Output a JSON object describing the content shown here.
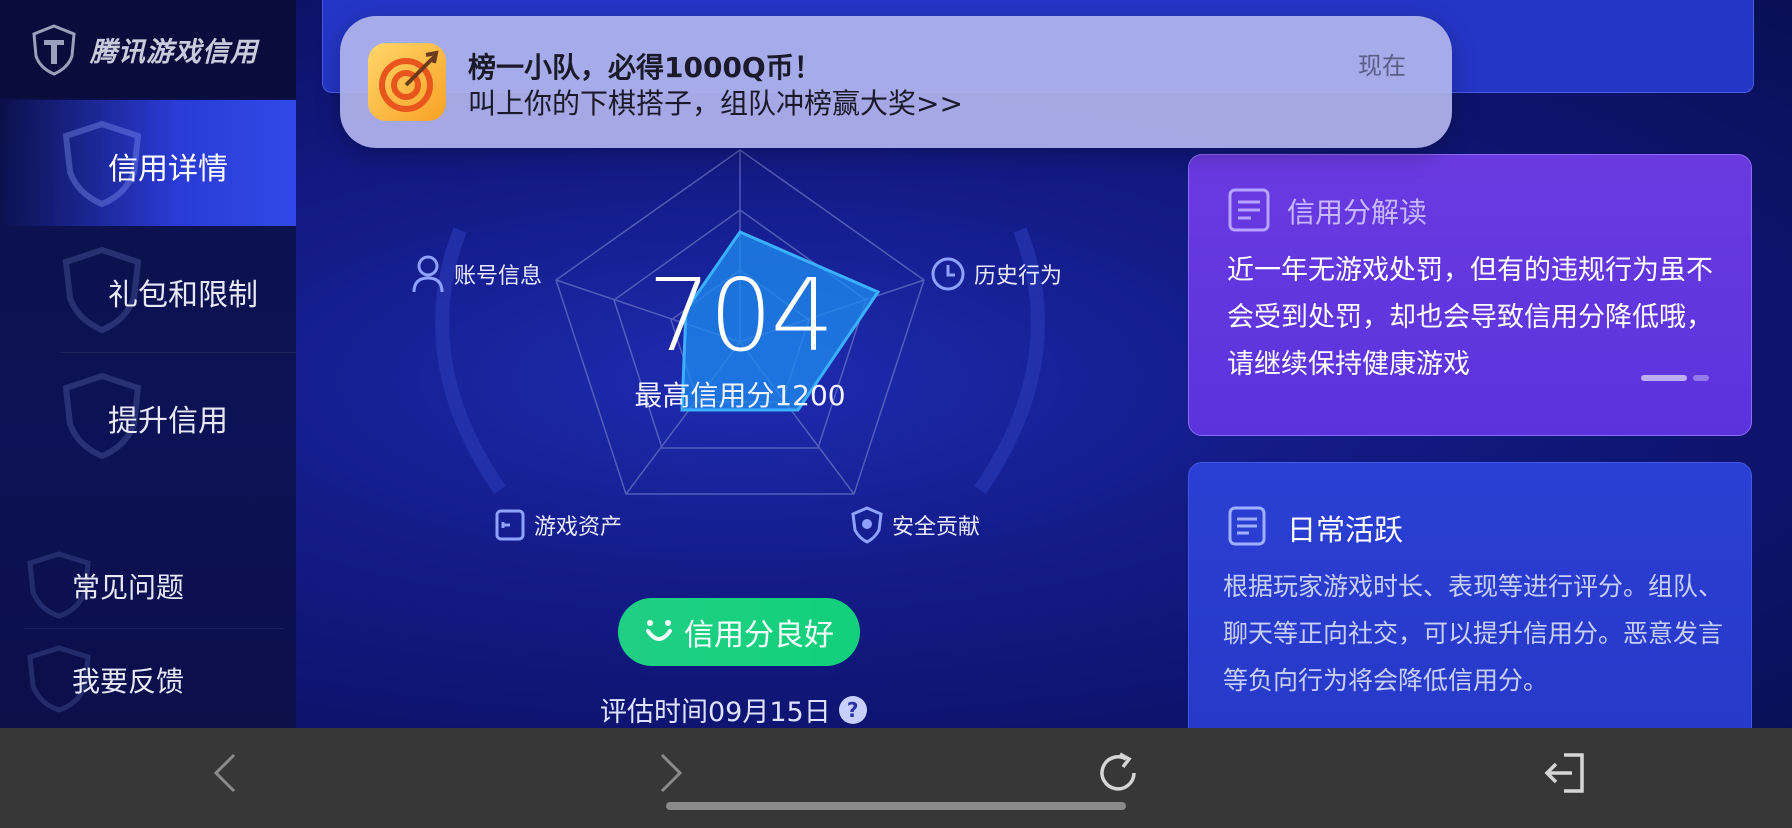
{
  "logo": {
    "text": "腾讯游戏信用"
  },
  "sidebar": {
    "items": [
      {
        "label": "信用详情",
        "active": true
      },
      {
        "label": "礼包和限制",
        "active": false
      },
      {
        "label": "提升信用",
        "active": false
      }
    ],
    "sub_items": [
      {
        "label": "常见问题"
      },
      {
        "label": "我要反馈"
      }
    ]
  },
  "notification": {
    "title": "榜一小队，必得1000Q币！",
    "text": "叫上你的下棋搭子，组队冲榜赢大奖>>",
    "time": "现在"
  },
  "radar": {
    "score": "704",
    "max_label": "最高信用分1200",
    "axes": {
      "top_left": "账号信息",
      "top_right": "历史行为",
      "bottom_left": "游戏资产",
      "bottom_right": "安全贡献"
    }
  },
  "status": {
    "label": "信用分良好",
    "color": "#16cf80"
  },
  "eval": {
    "text": "评估时间09月15日",
    "help_icon": "?"
  },
  "card1": {
    "title": "信用分解读",
    "body": "近一年无游戏处罚，但有的违规行为虽不会受到处罚，却也会导致信用分降低哦，请继续保持健康游戏"
  },
  "card2": {
    "title": "日常活跃",
    "body": "根据玩家游戏时长、表现等进行评分。组队、聊天等正向社交，可以提升信用分。恶意发言等负向行为将会降低信用分。"
  },
  "toolbar": {
    "icons": [
      "back-icon",
      "forward-icon",
      "refresh-icon",
      "exit-icon"
    ]
  },
  "colors": {
    "accent": "#3149e8",
    "card_purple": "#5a33dd",
    "card_blue": "#2638c6"
  }
}
